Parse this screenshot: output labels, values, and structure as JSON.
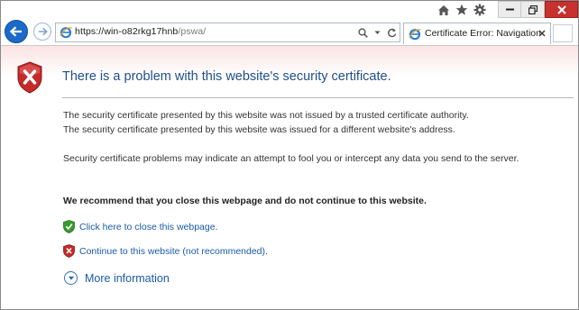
{
  "browser": {
    "toolbar_icons": [
      "home-icon",
      "favorites-star-icon",
      "settings-gear-icon"
    ],
    "window_controls": [
      "minimize-icon",
      "restore-icon",
      "close-icon"
    ],
    "address": {
      "host": "https://win-o82rkg17hnb",
      "path": "/pswa/"
    },
    "tab": {
      "title": "Certificate Error: Navigation..."
    }
  },
  "page": {
    "title": "There is a problem with this website's security certificate.",
    "line1": "The security certificate presented by this website was not issued by a trusted certificate authority.",
    "line2": "The security certificate presented by this website was issued for a different website's address.",
    "warning": "Security certificate problems may indicate an attempt to fool you or intercept any data you send to the server.",
    "recommendation": "We recommend that you close this webpage and do not continue to this website.",
    "close_link": "Click here to close this webpage.",
    "continue_link": "Continue to this website (not recommended).",
    "more_info": "More information"
  },
  "colors": {
    "title_blue": "#1f4e8c",
    "link_blue": "#1a5aa8",
    "close_red": "#c7312e",
    "shield_red": "#c42a2a",
    "shield_green": "#3a9b2e",
    "back_blue": "#1b6ac9"
  }
}
